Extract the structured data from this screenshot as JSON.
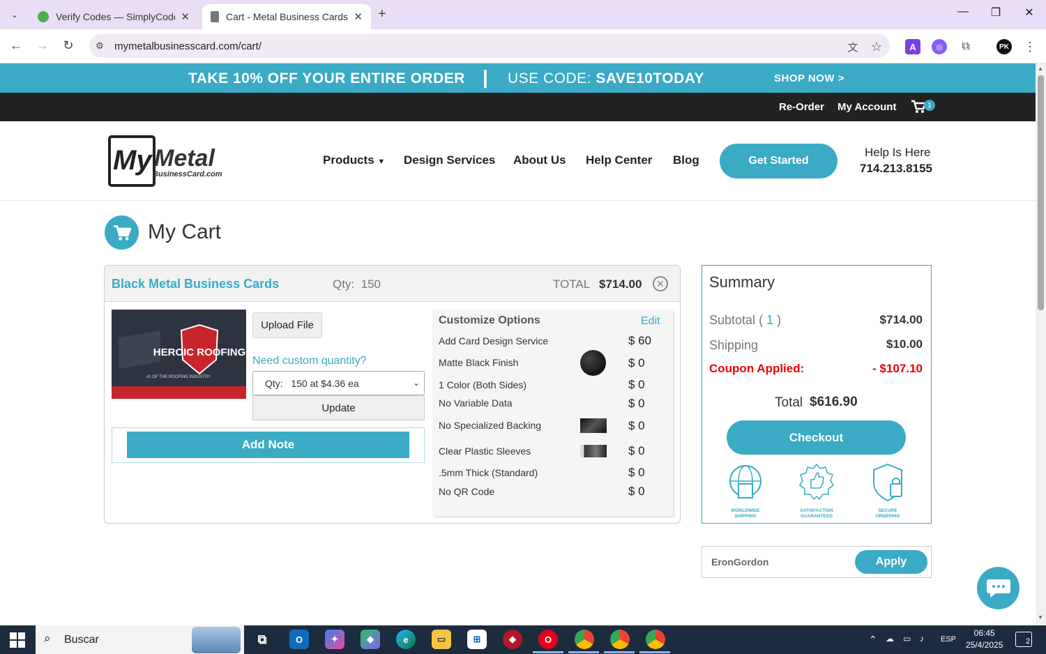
{
  "browser": {
    "tabs": [
      {
        "title": "Verify Codes — SimplyCodes",
        "active": false
      },
      {
        "title": "Cart - Metal Business Cards | My Metal Business Card",
        "active": true
      }
    ],
    "url": "mymetalbusinesscard.com/cart/",
    "profile_initials": "PK"
  },
  "promo": {
    "left": "TAKE 10% OFF YOUR ENTIRE ORDER",
    "separator": "|",
    "code_label": "USE CODE:",
    "code": "SAVE10TODAY",
    "cta": "SHOP NOW >"
  },
  "topbar": {
    "reorder": "Re-Order",
    "account": "My Account",
    "cart_count": "1"
  },
  "header": {
    "logo_text": "MyMetal BusinessCard.com",
    "nav": [
      "Products",
      "Design Services",
      "About Us",
      "Help Center",
      "Blog"
    ],
    "get_started": "Get Started",
    "help_label": "Help Is Here",
    "help_phone": "714.213.8155"
  },
  "cart": {
    "title": "My Cart",
    "item": {
      "name": "Black Metal Business Cards",
      "qty_label": "Qty:",
      "qty": "150",
      "total_label": "TOTAL",
      "total": "$714.00",
      "upload": "Upload File",
      "custom_qty": "Need custom quantity?",
      "qty_select": "Qty:   150 at $4.36 ea",
      "update": "Update",
      "add_note": "Add Note",
      "card_text": "HEROIC ROOFING",
      "card_tagline": "#1 OF THE ROOFING INDUSTRY"
    },
    "customize": {
      "title": "Customize Options",
      "edit": "Edit",
      "options": [
        {
          "label": "Add Card Design Service",
          "price": "$ 60",
          "swatch": ""
        },
        {
          "label": "Matte Black Finish",
          "price": "$ 0",
          "swatch": "circle"
        },
        {
          "label": "1 Color (Both Sides)",
          "price": "$ 0",
          "swatch": ""
        },
        {
          "label": "No Variable Data",
          "price": "$ 0",
          "swatch": ""
        },
        {
          "label": "No Specialized Backing",
          "price": "$ 0",
          "swatch": "card"
        },
        {
          "label": "Clear Plastic Sleeves",
          "price": "$ 0",
          "swatch": "sleeve"
        },
        {
          "label": ".5mm Thick (Standard)",
          "price": "$ 0",
          "swatch": ""
        },
        {
          "label": "No QR Code",
          "price": "$ 0",
          "swatch": ""
        }
      ]
    }
  },
  "summary": {
    "title": "Summary",
    "subtotal_label": "Subtotal",
    "subtotal_count": "1",
    "subtotal": "$714.00",
    "shipping_label": "Shipping",
    "shipping": "$10.00",
    "coupon_label": "Coupon Applied:",
    "coupon": "- $107.10",
    "total_label": "Total",
    "total": "$616.90",
    "checkout": "Checkout",
    "badges": [
      {
        "line1": "WORLDWIDE",
        "line2": "SHIPPING",
        "icon": "globe-box"
      },
      {
        "line1": "SATISFACTION",
        "line2": "GUARANTEED",
        "icon": "thumbs-up"
      },
      {
        "line1": "SECURE",
        "line2": "ORDERING",
        "icon": "shield-lock"
      }
    ],
    "coupon_input": "EronGordon",
    "apply": "Apply"
  },
  "taskbar": {
    "search": "Buscar",
    "lang": "ESP",
    "time": "06:45",
    "date": "25/4/2025",
    "notifications": "2"
  },
  "colors": {
    "accent": "#3aaac5",
    "dark": "#222222",
    "coupon": "#e00000",
    "tabbar": "#e9def5"
  }
}
